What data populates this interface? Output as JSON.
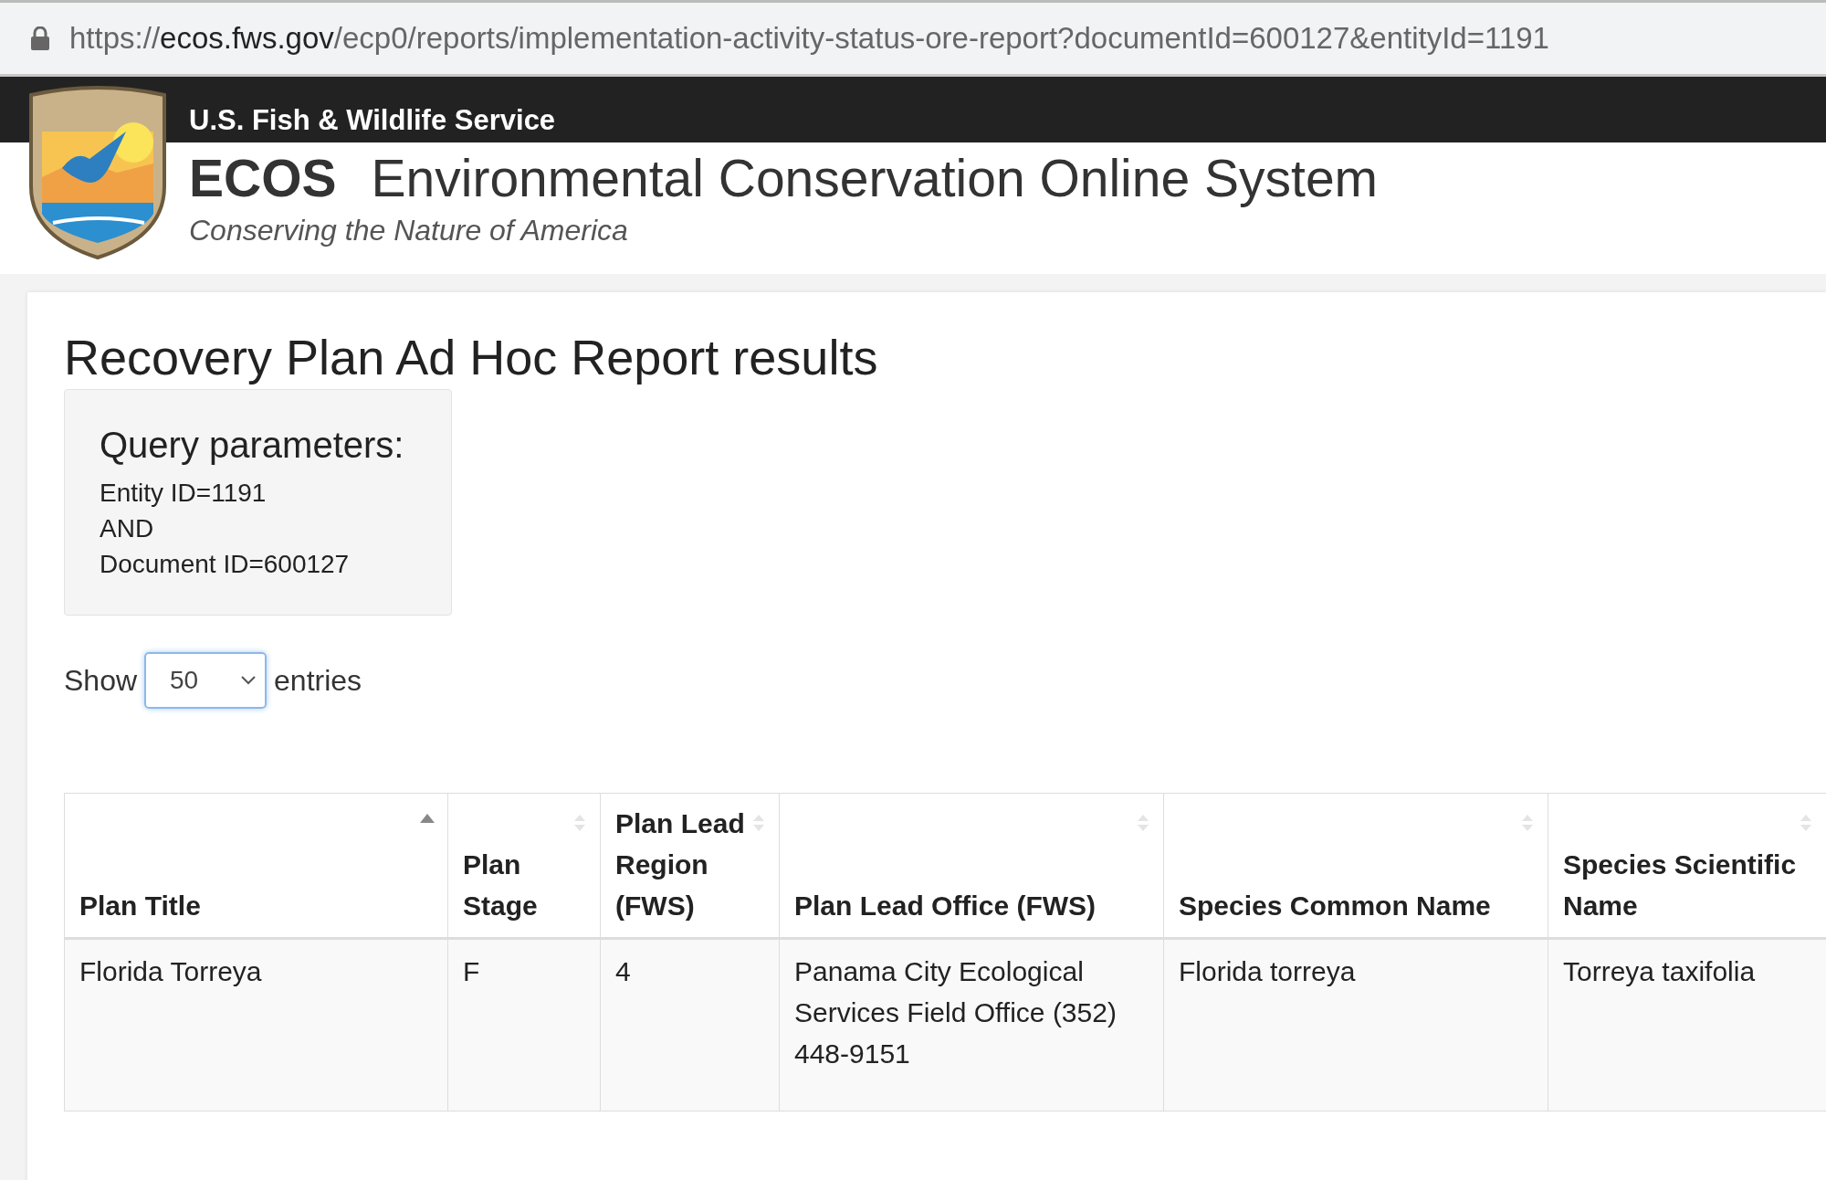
{
  "browser": {
    "url_host_prefix": "https://",
    "url_host": "ecos.fws.gov",
    "url_path": "/ecp0/reports/implementation-activity-status-ore-report?documentId=600127&entityId=1191"
  },
  "header": {
    "agency": "U.S. Fish & Wildlife Service",
    "acronym": "ECOS",
    "system_name": "Environmental Conservation Online System",
    "tagline": "Conserving the Nature of America"
  },
  "report": {
    "title": "Recovery Plan Ad Hoc Report results",
    "query": {
      "heading": "Query parameters:",
      "lines": [
        "Entity ID=1191",
        "AND",
        "Document ID=600127"
      ]
    },
    "show_entries": {
      "label_before": "Show",
      "value": "50",
      "label_after": "entries"
    },
    "table": {
      "columns": [
        {
          "label": "Plan Title",
          "sorted": true
        },
        {
          "label": "Plan Stage",
          "sorted": false
        },
        {
          "label": "Plan Lead Region (FWS)",
          "sorted": false
        },
        {
          "label": "Plan Lead Office (FWS)",
          "sorted": false
        },
        {
          "label": "Species Common Name",
          "sorted": false
        },
        {
          "label": "Species Scientific Name",
          "sorted": false
        }
      ],
      "rows": [
        [
          "Florida Torreya",
          "F",
          "4",
          "Panama City Ecological Services Field Office (352) 448-9151",
          "Florida torreya",
          "Torreya taxifolia"
        ]
      ]
    }
  }
}
